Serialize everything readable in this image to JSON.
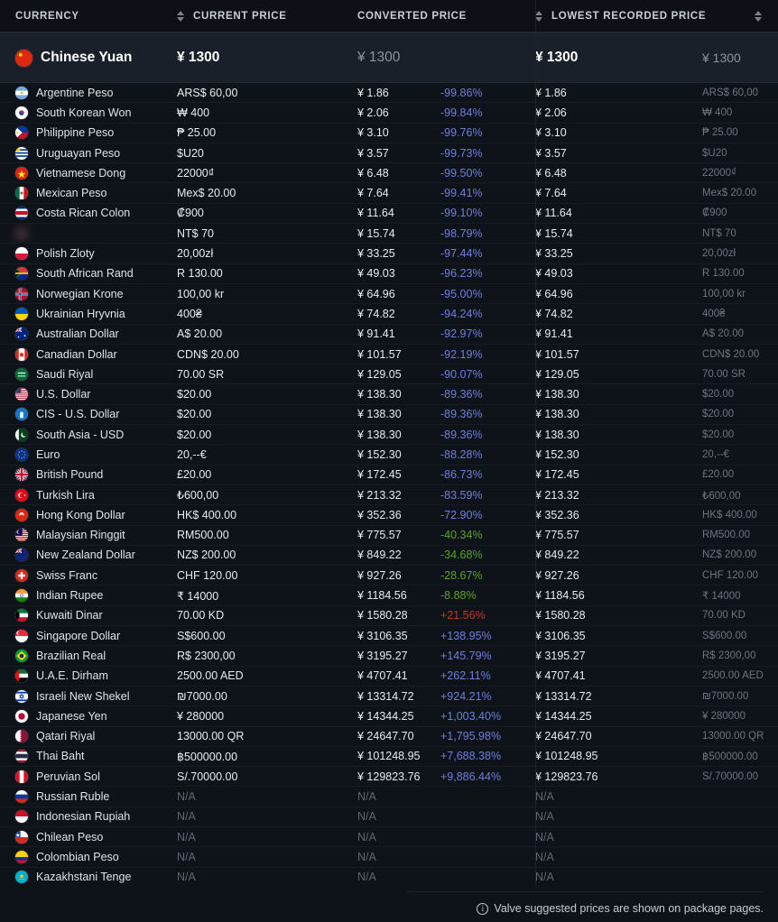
{
  "columns": {
    "currency": "CURRENCY",
    "current_price": "CURRENT PRICE",
    "converted_price": "CONVERTED PRICE",
    "lowest_recorded_price": "LOWEST RECORDED PRICE"
  },
  "footer": {
    "icon": "info-icon",
    "note": "Valve suggested prices are shown on package pages."
  },
  "colors": {
    "blue": "#6f7fe0",
    "green": "#5ba32b",
    "red": "#c0392b",
    "base_row_bg": "#1a2029",
    "page_bg": "#0e1319"
  },
  "base_row": {
    "flag": "flag-cn",
    "name": "Chinese Yuan",
    "current": "¥ 1300",
    "converted": "¥ 1300",
    "pct": "",
    "lowest": "¥ 1300",
    "local": "¥ 1300"
  },
  "rows": [
    {
      "flag": "flag-ar",
      "name": "Argentine Peso",
      "current": "ARS$ 60,00",
      "converted": "¥ 1.86",
      "pct": "-99.86%",
      "pct_color": "blue",
      "lowest": "¥ 1.86",
      "local": "ARS$ 60,00"
    },
    {
      "flag": "flag-kr",
      "name": "South Korean Won",
      "current": "₩ 400",
      "converted": "¥ 2.06",
      "pct": "-99.84%",
      "pct_color": "blue",
      "lowest": "¥ 2.06",
      "local": "₩ 400"
    },
    {
      "flag": "flag-ph",
      "name": "Philippine Peso",
      "current": "₱ 25.00",
      "converted": "¥ 3.10",
      "pct": "-99.76%",
      "pct_color": "blue",
      "lowest": "¥ 3.10",
      "local": "₱ 25.00"
    },
    {
      "flag": "flag-uy",
      "name": "Uruguayan Peso",
      "current": "$U20",
      "converted": "¥ 3.57",
      "pct": "-99.73%",
      "pct_color": "blue",
      "lowest": "¥ 3.57",
      "local": "$U20"
    },
    {
      "flag": "flag-vn",
      "name": "Vietnamese Dong",
      "current": "22000₫",
      "converted": "¥ 6.48",
      "pct": "-99.50%",
      "pct_color": "blue",
      "lowest": "¥ 6.48",
      "local": "22000₫"
    },
    {
      "flag": "flag-mx",
      "name": "Mexican Peso",
      "current": "Mex$ 20.00",
      "converted": "¥ 7.64",
      "pct": "-99.41%",
      "pct_color": "blue",
      "lowest": "¥ 7.64",
      "local": "Mex$ 20.00"
    },
    {
      "flag": "flag-cr",
      "name": "Costa Rican Colon",
      "current": "₡900",
      "converted": "¥ 11.64",
      "pct": "-99.10%",
      "pct_color": "blue",
      "lowest": "¥ 11.64",
      "local": "₡900"
    },
    {
      "flag": "flag-blur",
      "name": "",
      "current": "NT$ 70",
      "converted": "¥ 15.74",
      "pct": "-98.79%",
      "pct_color": "blue",
      "lowest": "¥ 15.74",
      "local": "NT$ 70",
      "blurred": true
    },
    {
      "flag": "flag-pl",
      "name": "Polish Zloty",
      "current": "20,00zł",
      "converted": "¥ 33.25",
      "pct": "-97.44%",
      "pct_color": "blue",
      "lowest": "¥ 33.25",
      "local": "20,00zł"
    },
    {
      "flag": "flag-za",
      "name": "South African Rand",
      "current": "R 130.00",
      "converted": "¥ 49.03",
      "pct": "-96.23%",
      "pct_color": "blue",
      "lowest": "¥ 49.03",
      "local": "R 130.00"
    },
    {
      "flag": "flag-no",
      "name": "Norwegian Krone",
      "current": "100,00 kr",
      "converted": "¥ 64.96",
      "pct": "-95.00%",
      "pct_color": "blue",
      "lowest": "¥ 64.96",
      "local": "100,00 kr"
    },
    {
      "flag": "flag-ua",
      "name": "Ukrainian Hryvnia",
      "current": "400₴",
      "converted": "¥ 74.82",
      "pct": "-94.24%",
      "pct_color": "blue",
      "lowest": "¥ 74.82",
      "local": "400₴"
    },
    {
      "flag": "flag-au",
      "name": "Australian Dollar",
      "current": "A$ 20.00",
      "converted": "¥ 91.41",
      "pct": "-92.97%",
      "pct_color": "blue",
      "lowest": "¥ 91.41",
      "local": "A$ 20.00"
    },
    {
      "flag": "flag-ca",
      "name": "Canadian Dollar",
      "current": "CDN$ 20.00",
      "converted": "¥ 101.57",
      "pct": "-92.19%",
      "pct_color": "blue",
      "lowest": "¥ 101.57",
      "local": "CDN$ 20.00"
    },
    {
      "flag": "flag-sa",
      "name": "Saudi Riyal",
      "current": "70.00 SR",
      "converted": "¥ 129.05",
      "pct": "-90.07%",
      "pct_color": "blue",
      "lowest": "¥ 129.05",
      "local": "70.00 SR"
    },
    {
      "flag": "flag-us",
      "name": "U.S. Dollar",
      "current": "$20.00",
      "converted": "¥ 138.30",
      "pct": "-89.36%",
      "pct_color": "blue",
      "lowest": "¥ 138.30",
      "local": "$20.00"
    },
    {
      "flag": "flag-cis",
      "name": "CIS - U.S. Dollar",
      "current": "$20.00",
      "converted": "¥ 138.30",
      "pct": "-89.36%",
      "pct_color": "blue",
      "lowest": "¥ 138.30",
      "local": "$20.00"
    },
    {
      "flag": "flag-sasia",
      "name": "South Asia - USD",
      "current": "$20.00",
      "converted": "¥ 138.30",
      "pct": "-89.36%",
      "pct_color": "blue",
      "lowest": "¥ 138.30",
      "local": "$20.00"
    },
    {
      "flag": "flag-eu",
      "name": "Euro",
      "current": "20,--€",
      "converted": "¥ 152.30",
      "pct": "-88.28%",
      "pct_color": "blue",
      "lowest": "¥ 152.30",
      "local": "20,--€"
    },
    {
      "flag": "flag-gb",
      "name": "British Pound",
      "current": "£20.00",
      "converted": "¥ 172.45",
      "pct": "-86.73%",
      "pct_color": "blue",
      "lowest": "¥ 172.45",
      "local": "£20.00"
    },
    {
      "flag": "flag-tr",
      "name": "Turkish Lira",
      "current": "₺600,00",
      "converted": "¥ 213.32",
      "pct": "-83.59%",
      "pct_color": "blue",
      "lowest": "¥ 213.32",
      "local": "₺600,00"
    },
    {
      "flag": "flag-hk",
      "name": "Hong Kong Dollar",
      "current": "HK$ 400.00",
      "converted": "¥ 352.36",
      "pct": "-72.90%",
      "pct_color": "blue",
      "lowest": "¥ 352.36",
      "local": "HK$ 400.00"
    },
    {
      "flag": "flag-my",
      "name": "Malaysian Ringgit",
      "current": "RM500.00",
      "converted": "¥ 775.57",
      "pct": "-40.34%",
      "pct_color": "green",
      "lowest": "¥ 775.57",
      "local": "RM500.00"
    },
    {
      "flag": "flag-nz",
      "name": "New Zealand Dollar",
      "current": "NZ$ 200.00",
      "converted": "¥ 849.22",
      "pct": "-34.68%",
      "pct_color": "green",
      "lowest": "¥ 849.22",
      "local": "NZ$ 200.00"
    },
    {
      "flag": "flag-ch",
      "name": "Swiss Franc",
      "current": "CHF 120.00",
      "converted": "¥ 927.26",
      "pct": "-28.67%",
      "pct_color": "green",
      "lowest": "¥ 927.26",
      "local": "CHF 120.00"
    },
    {
      "flag": "flag-in",
      "name": "Indian Rupee",
      "current": "₹ 14000",
      "converted": "¥ 1184.56",
      "pct": "-8.88%",
      "pct_color": "green",
      "lowest": "¥ 1184.56",
      "local": "₹ 14000"
    },
    {
      "flag": "flag-kw",
      "name": "Kuwaiti Dinar",
      "current": "70.00 KD",
      "converted": "¥ 1580.28",
      "pct": "+21.56%",
      "pct_color": "red",
      "lowest": "¥ 1580.28",
      "local": "70.00 KD"
    },
    {
      "flag": "flag-sg",
      "name": "Singapore Dollar",
      "current": "S$600.00",
      "converted": "¥ 3106.35",
      "pct": "+138.95%",
      "pct_color": "blue",
      "lowest": "¥ 3106.35",
      "local": "S$600.00"
    },
    {
      "flag": "flag-br",
      "name": "Brazilian Real",
      "current": "R$ 2300,00",
      "converted": "¥ 3195.27",
      "pct": "+145.79%",
      "pct_color": "blue",
      "lowest": "¥ 3195.27",
      "local": "R$ 2300,00"
    },
    {
      "flag": "flag-ae",
      "name": "U.A.E. Dirham",
      "current": "2500.00 AED",
      "converted": "¥ 4707.41",
      "pct": "+262.11%",
      "pct_color": "blue",
      "lowest": "¥ 4707.41",
      "local": "2500.00 AED"
    },
    {
      "flag": "flag-il",
      "name": "Israeli New Shekel",
      "current": "₪7000.00",
      "converted": "¥ 13314.72",
      "pct": "+924.21%",
      "pct_color": "blue",
      "lowest": "¥ 13314.72",
      "local": "₪7000.00"
    },
    {
      "flag": "flag-jp",
      "name": "Japanese Yen",
      "current": "¥ 280000",
      "converted": "¥ 14344.25",
      "pct": "+1,003.40%",
      "pct_color": "blue",
      "lowest": "¥ 14344.25",
      "local": "¥ 280000"
    },
    {
      "flag": "flag-qa",
      "name": "Qatari Riyal",
      "current": "13000.00 QR",
      "converted": "¥ 24647.70",
      "pct": "+1,795.98%",
      "pct_color": "blue",
      "lowest": "¥ 24647.70",
      "local": "13000.00 QR"
    },
    {
      "flag": "flag-th",
      "name": "Thai Baht",
      "current": "฿500000.00",
      "converted": "¥ 101248.95",
      "pct": "+7,688.38%",
      "pct_color": "blue",
      "lowest": "¥ 101248.95",
      "local": "฿500000.00"
    },
    {
      "flag": "flag-pe",
      "name": "Peruvian Sol",
      "current": "S/.70000.00",
      "converted": "¥ 129823.76",
      "pct": "+9,886.44%",
      "pct_color": "blue",
      "lowest": "¥ 129823.76",
      "local": "S/.70000.00"
    },
    {
      "flag": "flag-ru",
      "name": "Russian Ruble",
      "current": "N/A",
      "converted": "N/A",
      "pct": "",
      "lowest": "N/A",
      "local": "",
      "na": true
    },
    {
      "flag": "flag-id",
      "name": "Indonesian Rupiah",
      "current": "N/A",
      "converted": "N/A",
      "pct": "",
      "lowest": "N/A",
      "local": "",
      "na": true
    },
    {
      "flag": "flag-cl",
      "name": "Chilean Peso",
      "current": "N/A",
      "converted": "N/A",
      "pct": "",
      "lowest": "N/A",
      "local": "",
      "na": true
    },
    {
      "flag": "flag-co",
      "name": "Colombian Peso",
      "current": "N/A",
      "converted": "N/A",
      "pct": "",
      "lowest": "N/A",
      "local": "",
      "na": true
    },
    {
      "flag": "flag-kz",
      "name": "Kazakhstani Tenge",
      "current": "N/A",
      "converted": "N/A",
      "pct": "",
      "lowest": "N/A",
      "local": "",
      "na": true
    }
  ]
}
